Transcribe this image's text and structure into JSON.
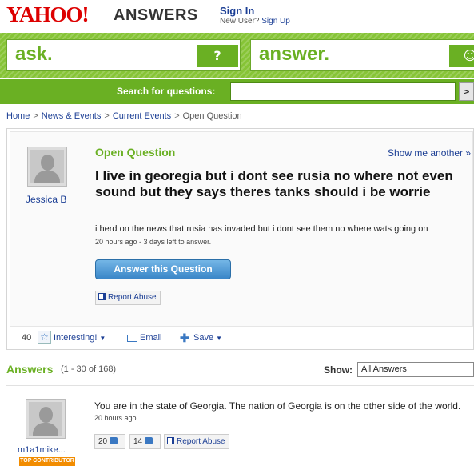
{
  "header": {
    "logo": "YAHOO!",
    "logo_sub": "ANSWERS",
    "sign_in": "Sign In",
    "new_user": "New User?",
    "sign_up": "Sign Up"
  },
  "band": {
    "ask_label": "ask.",
    "ask_tag": "?",
    "answer_label": "answer.",
    "answer_tag": "☺"
  },
  "search": {
    "label": "Search for questions:",
    "value": "",
    "button": ">"
  },
  "breadcrumb": [
    "Home",
    "News & Events",
    "Current Events",
    "Open Question"
  ],
  "question": {
    "user": "Jessica B",
    "status": "Open Question",
    "show_another": "Show me another »",
    "title": "I live in georegia but i dont see rusia no where not even sound but they says theres tanks should i be worrie",
    "body": "i herd on the news that rusia has invaded but i dont see them no where wats going on",
    "meta": "20 hours ago - 3 days left to answer.",
    "answer_button": "Answer this Question",
    "report_abuse": "Report Abuse",
    "interesting_count": "40",
    "interesting_label": "Interesting!",
    "email_label": "Email",
    "save_label": "Save"
  },
  "answers": {
    "title": "Answers",
    "range": "(1 - 30 of 168)",
    "show_label": "Show:",
    "show_value": "All Answers",
    "items": [
      {
        "user": "m1a1mike...",
        "badge": "TOP CONTRIBUTOR",
        "body": "You are in the state of Georgia. The nation of Georgia is on the other side of the world.",
        "meta": "20 hours ago",
        "thumbs_up": "20",
        "thumbs_down": "14",
        "report_abuse": "Report Abuse"
      }
    ]
  },
  "colors": {
    "yahoo_red": "#dd0000",
    "answers_green": "#6ab023",
    "link_blue": "#1c3f95",
    "button_blue": "#3a86c8"
  }
}
